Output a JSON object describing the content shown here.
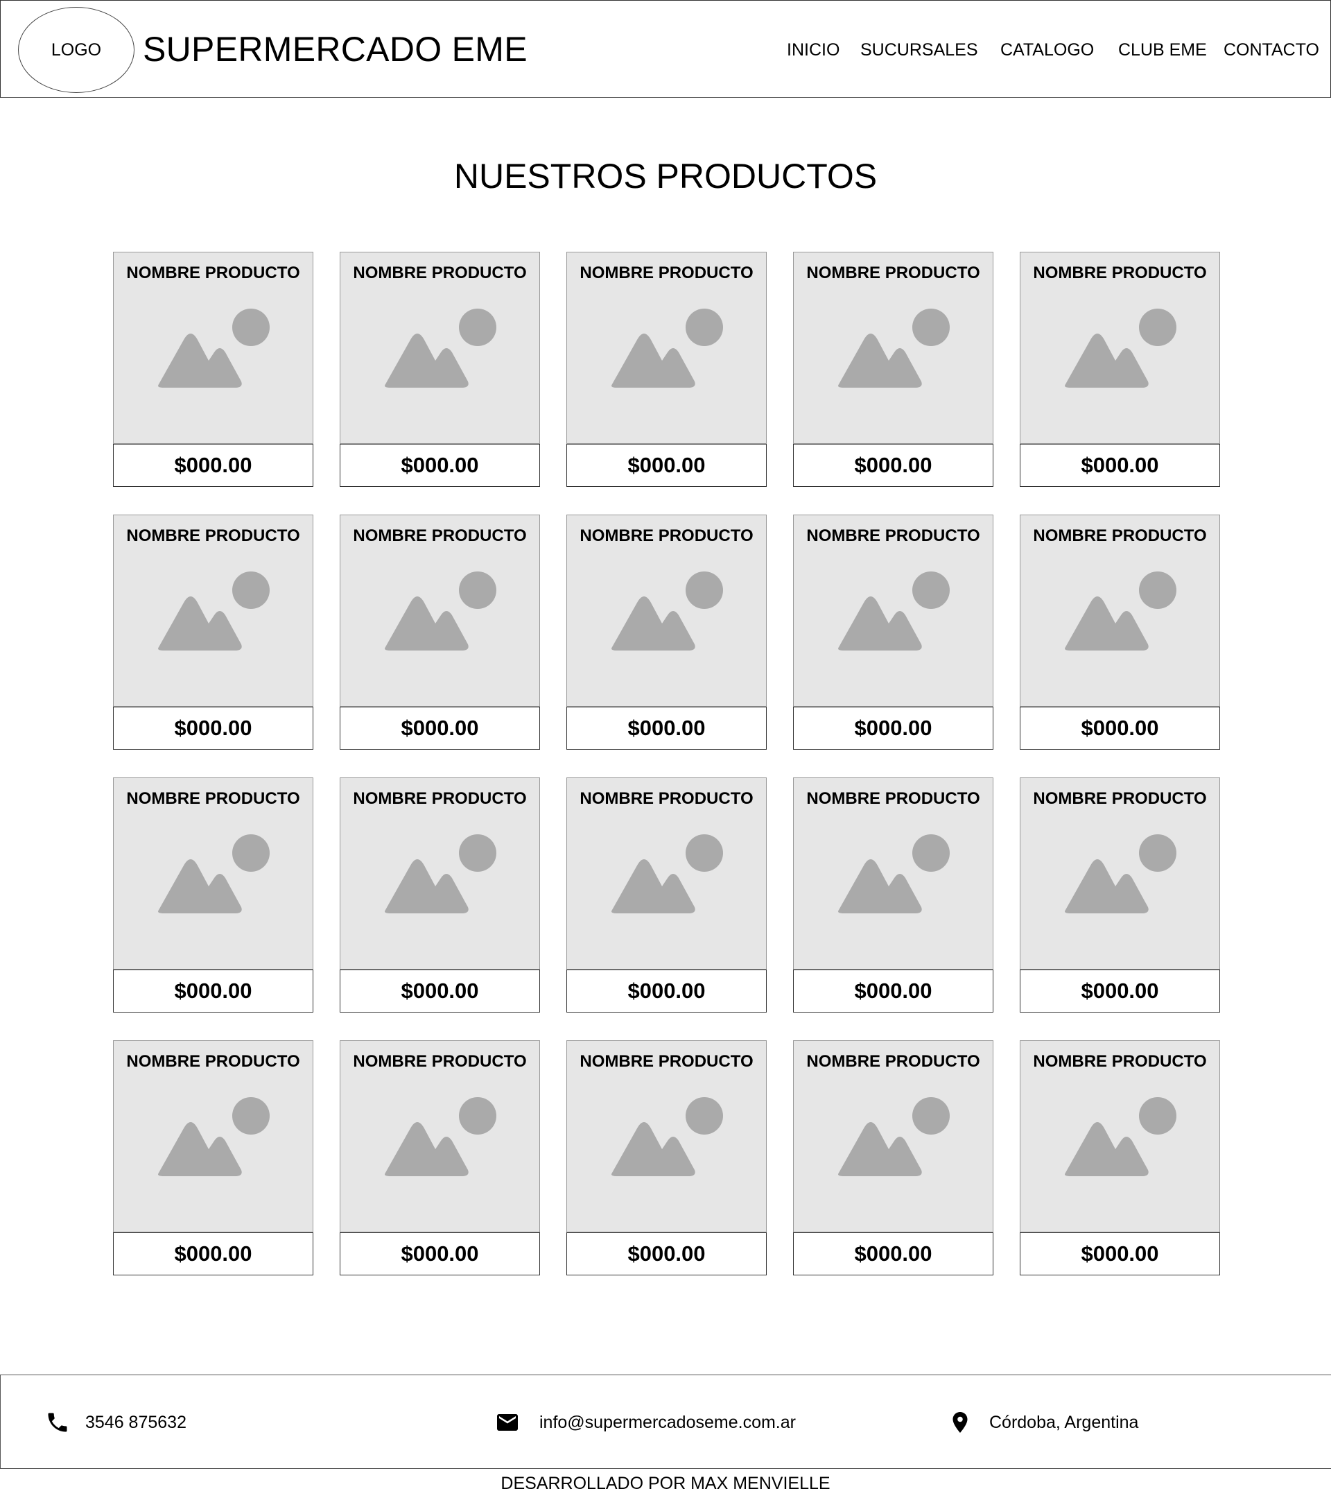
{
  "header": {
    "logo_text": "LOGO",
    "brand_title": "SUPERMERCADO EME",
    "nav": [
      {
        "label": "INICIO"
      },
      {
        "label": "SUCURSALES"
      },
      {
        "label": "CATALOGO"
      },
      {
        "label": "CLUB EME"
      },
      {
        "label": "CONTACTO"
      }
    ]
  },
  "main": {
    "title": "NUESTROS PRODUCTOS",
    "products": [
      {
        "name": "NOMBRE PRODUCTO",
        "price": "$000.00",
        "icon": "image-placeholder-icon"
      },
      {
        "name": "NOMBRE PRODUCTO",
        "price": "$000.00",
        "icon": "image-placeholder-icon"
      },
      {
        "name": "NOMBRE PRODUCTO",
        "price": "$000.00",
        "icon": "image-placeholder-icon"
      },
      {
        "name": "NOMBRE PRODUCTO",
        "price": "$000.00",
        "icon": "image-placeholder-icon"
      },
      {
        "name": "NOMBRE PRODUCTO",
        "price": "$000.00",
        "icon": "image-placeholder-icon"
      },
      {
        "name": "NOMBRE PRODUCTO",
        "price": "$000.00",
        "icon": "image-placeholder-icon"
      },
      {
        "name": "NOMBRE PRODUCTO",
        "price": "$000.00",
        "icon": "image-placeholder-icon"
      },
      {
        "name": "NOMBRE PRODUCTO",
        "price": "$000.00",
        "icon": "image-placeholder-icon"
      },
      {
        "name": "NOMBRE PRODUCTO",
        "price": "$000.00",
        "icon": "image-placeholder-icon"
      },
      {
        "name": "NOMBRE PRODUCTO",
        "price": "$000.00",
        "icon": "image-placeholder-icon"
      },
      {
        "name": "NOMBRE PRODUCTO",
        "price": "$000.00",
        "icon": "image-placeholder-icon"
      },
      {
        "name": "NOMBRE PRODUCTO",
        "price": "$000.00",
        "icon": "image-placeholder-icon"
      },
      {
        "name": "NOMBRE PRODUCTO",
        "price": "$000.00",
        "icon": "image-placeholder-icon"
      },
      {
        "name": "NOMBRE PRODUCTO",
        "price": "$000.00",
        "icon": "image-placeholder-icon"
      },
      {
        "name": "NOMBRE PRODUCTO",
        "price": "$000.00",
        "icon": "image-placeholder-icon"
      },
      {
        "name": "NOMBRE PRODUCTO",
        "price": "$000.00",
        "icon": "image-placeholder-icon"
      },
      {
        "name": "NOMBRE PRODUCTO",
        "price": "$000.00",
        "icon": "image-placeholder-icon"
      },
      {
        "name": "NOMBRE PRODUCTO",
        "price": "$000.00",
        "icon": "image-placeholder-icon"
      },
      {
        "name": "NOMBRE PRODUCTO",
        "price": "$000.00",
        "icon": "image-placeholder-icon"
      },
      {
        "name": "NOMBRE PRODUCTO",
        "price": "$000.00",
        "icon": "image-placeholder-icon"
      }
    ]
  },
  "footer": {
    "phone": {
      "icon": "phone-icon",
      "text": "3546 875632"
    },
    "email": {
      "icon": "mail-icon",
      "text": "info@supermercadoseme.com.ar"
    },
    "location": {
      "icon": "location-pin-icon",
      "text": "Córdoba, Argentina"
    },
    "credits": "DESARROLLADO POR MAX MENVIELLE"
  },
  "colors": {
    "card_background": "#e6e6e6",
    "placeholder_gray": "#aaaaaa",
    "border": "#333333",
    "text": "#000000"
  }
}
